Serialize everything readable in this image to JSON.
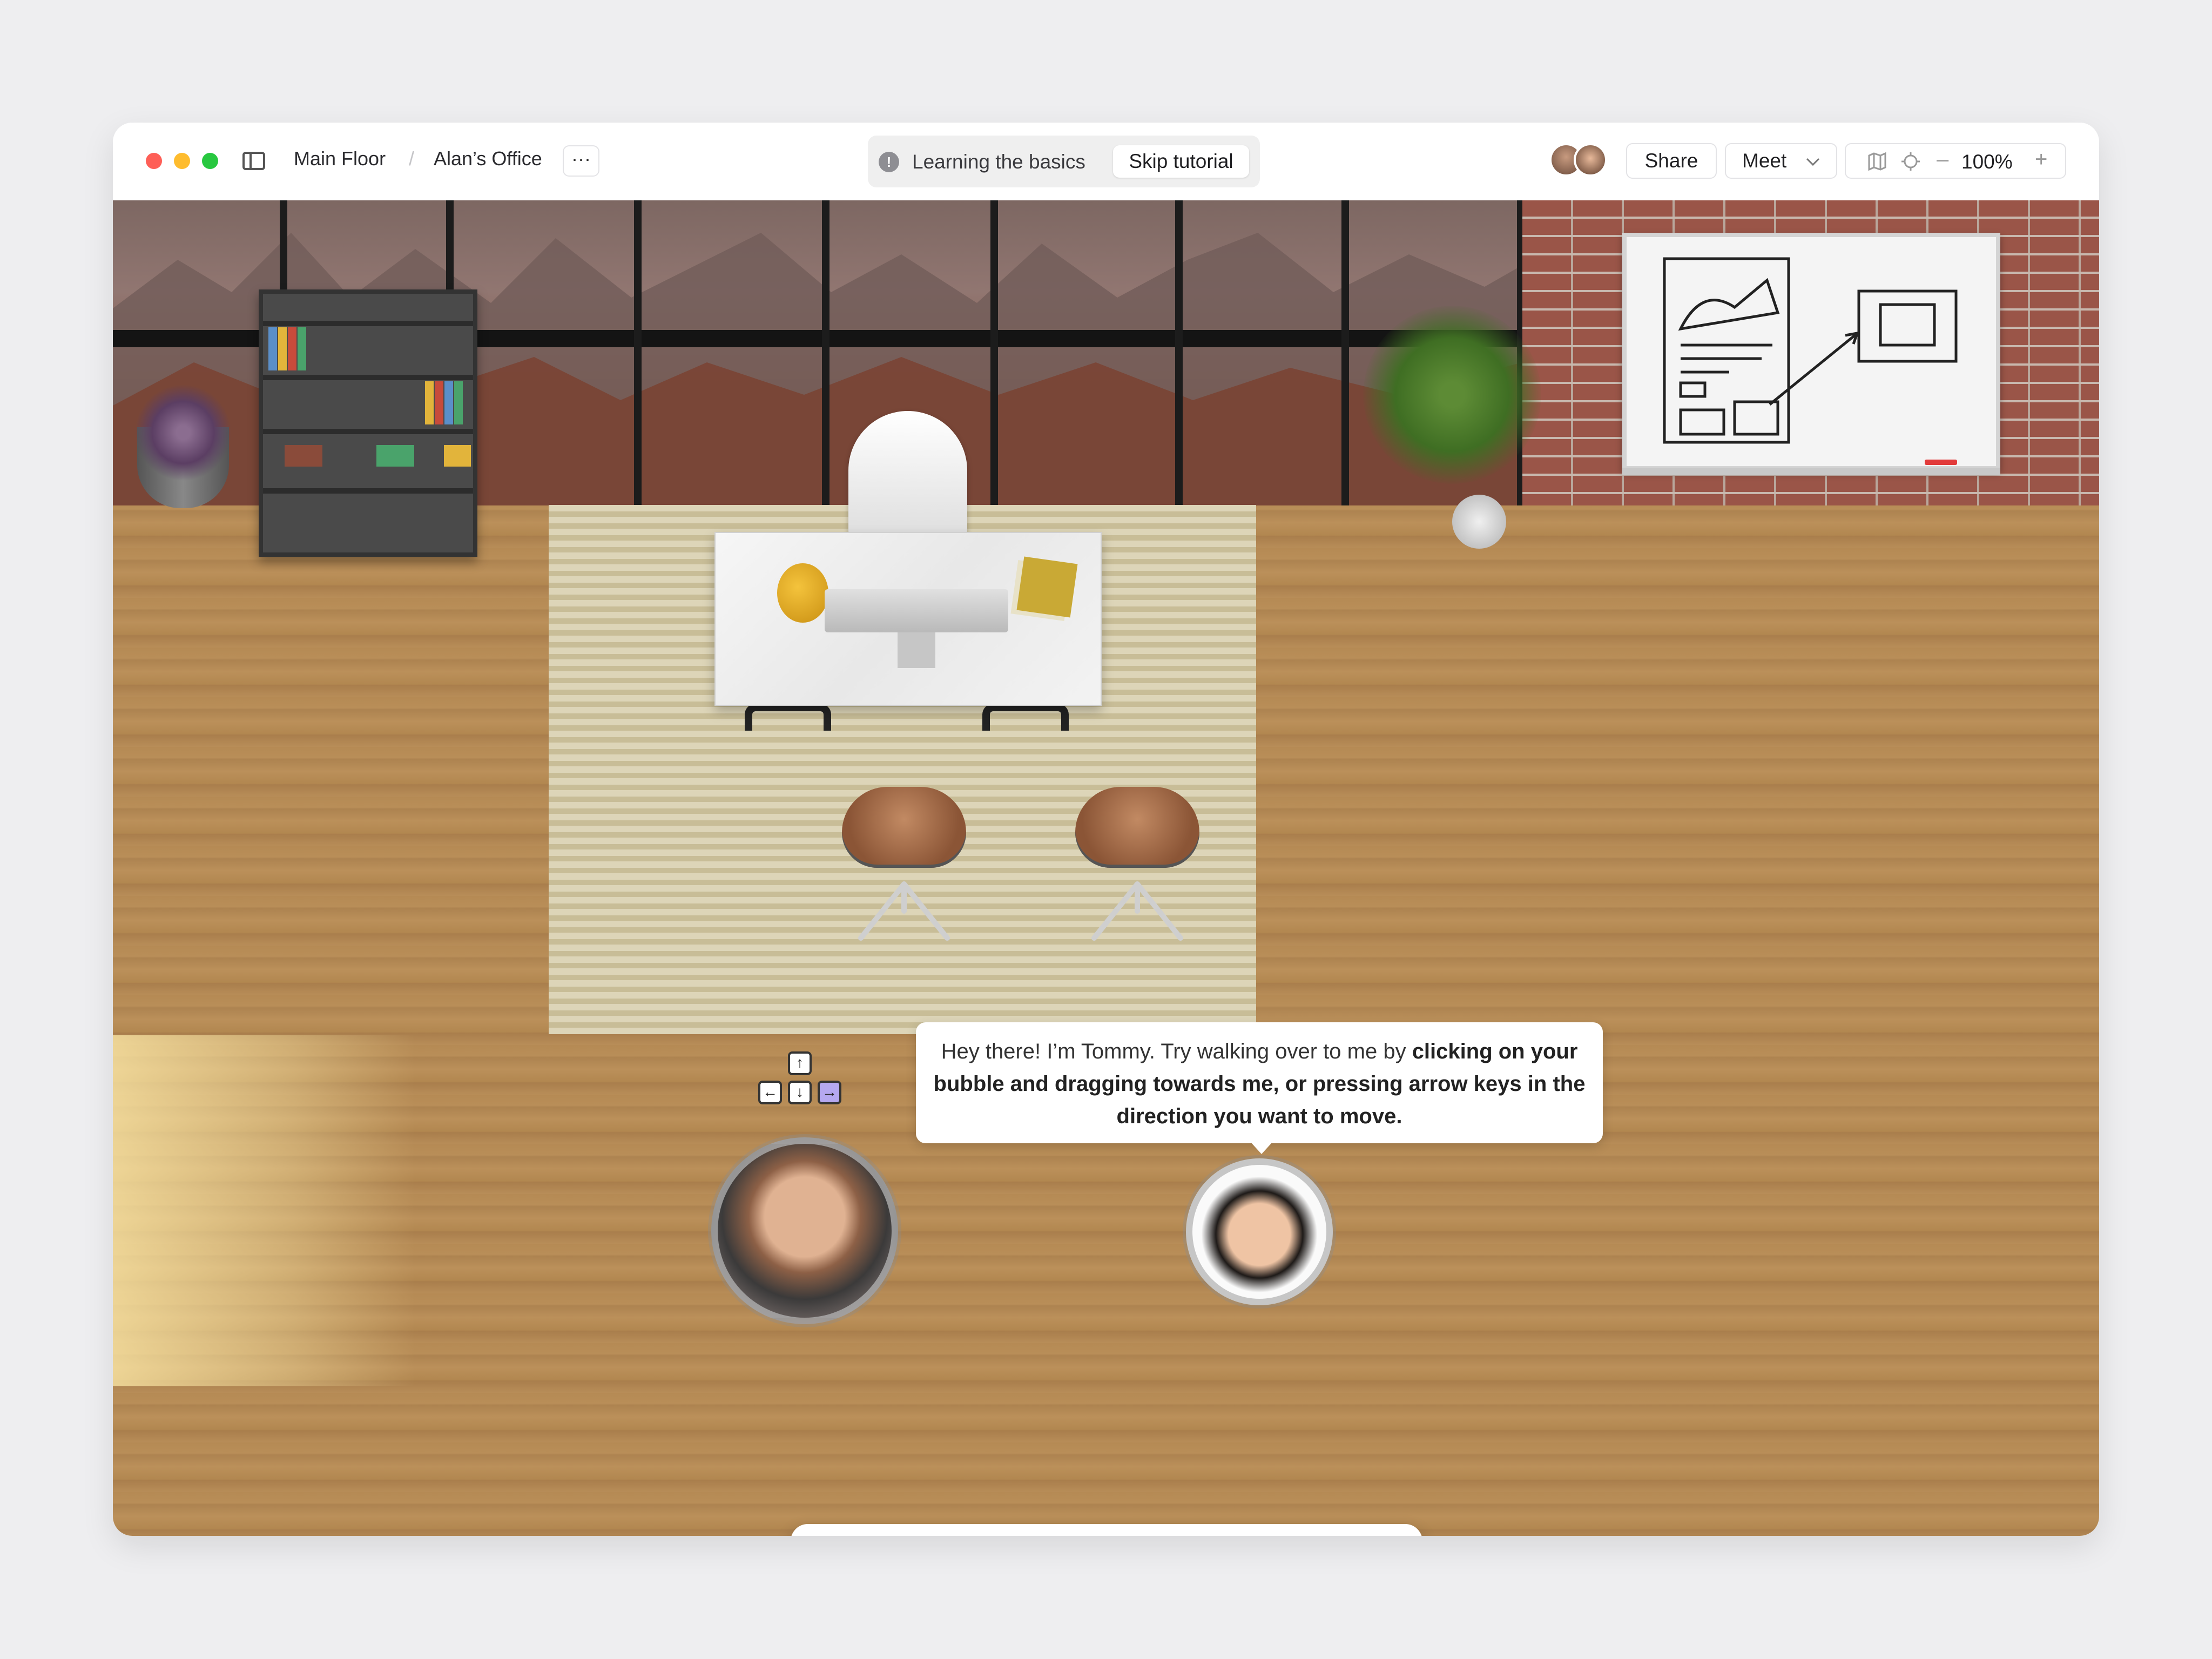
{
  "window": {
    "breadcrumb": {
      "floor": "Main Floor",
      "separator": "/",
      "room": "Alan’s Office",
      "more_label": "···"
    },
    "tutorial": {
      "label": "Learning the basics",
      "info_symbol": "!",
      "skip_label": "Skip tutorial"
    },
    "header": {
      "share_label": "Share",
      "meet_label": "Meet",
      "zoom_value": "100%",
      "zoom_minus": "–",
      "zoom_plus": "+"
    }
  },
  "tutorial_bubble": {
    "text_plain_1": "Hey there! I’m Tommy.  Try walking over to me by ",
    "text_bold": "clicking on your bubble and dragging towards me, or pressing arrow keys in the direction you want to move."
  },
  "arrow_keys": {
    "up": "↑",
    "left": "←",
    "down": "↓",
    "right": "→",
    "active": "right"
  },
  "toolbar": {
    "buttons": [
      "screen-share",
      "open-app",
      "microphone",
      "camera",
      "chat",
      "fullscreen",
      "leave"
    ]
  },
  "colors": {
    "accent_leave": "#e84a5f",
    "arrow_active": "#b5a8f0",
    "traffic_red": "#fe5f57",
    "traffic_yellow": "#febc2e",
    "traffic_green": "#28c840"
  }
}
